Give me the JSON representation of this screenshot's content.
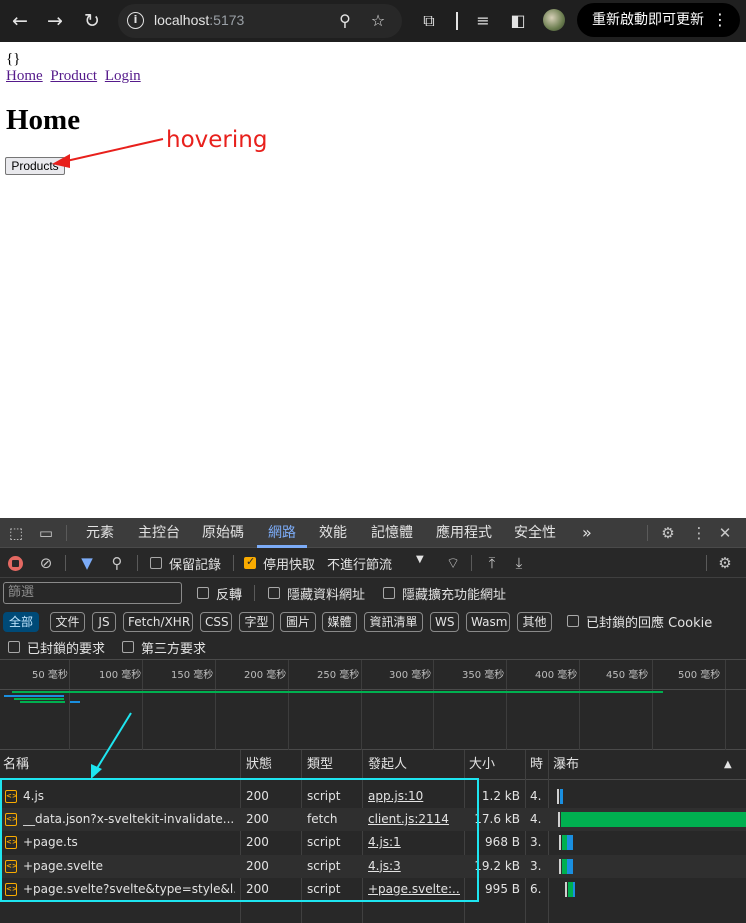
{
  "browser": {
    "url_host": "localhost",
    "url_port": ":5173",
    "update_button": "重新啟動即可更新"
  },
  "page": {
    "json_output": "{}",
    "nav_links": [
      "Home",
      "Product",
      "Login"
    ],
    "heading": "Home",
    "products_button": "Products"
  },
  "annotations": {
    "hovering_label": "hovering"
  },
  "devtools": {
    "tabs": [
      "元素",
      "主控台",
      "原始碼",
      "網路",
      "效能",
      "記憶體",
      "應用程式",
      "安全性"
    ],
    "active_tab": "網路",
    "more_tabs": "»",
    "toolbar": {
      "preserve_log": "保留記錄",
      "disable_cache": "停用快取",
      "throttling": "不進行節流"
    },
    "filter": {
      "placeholder": "篩選",
      "invert": "反轉",
      "hide_data_urls": "隱藏資料網址",
      "hide_extension_urls": "隱藏擴充功能網址"
    },
    "type_chips": [
      "全部",
      "文件",
      "JS",
      "Fetch/XHR",
      "CSS",
      "字型",
      "圖片",
      "媒體",
      "資訊清單",
      "WS",
      "Wasm",
      "其他"
    ],
    "blocked_cookies": "已封鎖的回應 Cookie",
    "blocked_requests": "已封鎖的要求",
    "third_party": "第三方要求",
    "timeline_ticks": [
      "50 毫秒",
      "100 毫秒",
      "150 毫秒",
      "200 毫秒",
      "250 毫秒",
      "300 毫秒",
      "350 毫秒",
      "400 毫秒",
      "450 毫秒",
      "500 毫秒"
    ],
    "columns": {
      "name": "名稱",
      "status": "狀態",
      "type": "類型",
      "initiator": "發起人",
      "size": "大小",
      "time": "時",
      "waterfall": "瀑布"
    },
    "requests": [
      {
        "name": "4.js",
        "status": "200",
        "type": "script",
        "initiator": "app.js:10",
        "size": "1.2 kB",
        "time": "4.",
        "wf_start_ms": 1,
        "wf_waiting_ms": 0,
        "wf_download_ms": 3
      },
      {
        "name": "__data.json?x-sveltekit-invalidate...",
        "status": "200",
        "type": "fetch",
        "initiator": "client.js:2114",
        "size": "17.6 kB",
        "time": "4.",
        "wf_start_ms": 2,
        "wf_waiting_ms": 0,
        "wf_download_ms": 200
      },
      {
        "name": "+page.ts",
        "status": "200",
        "type": "script",
        "initiator": "4.js:1",
        "size": "968 B",
        "time": "3.",
        "wf_start_ms": 3,
        "wf_waiting_ms": 2,
        "wf_download_ms": 6
      },
      {
        "name": "+page.svelte",
        "status": "200",
        "type": "script",
        "initiator": "4.js:3",
        "size": "19.2 kB",
        "time": "3.",
        "wf_start_ms": 3,
        "wf_waiting_ms": 2,
        "wf_download_ms": 6
      },
      {
        "name": "+page.svelte?svelte&type=style&l...",
        "status": "200",
        "type": "script",
        "initiator": "+page.svelte:...",
        "size": "995 B",
        "time": "6.",
        "wf_start_ms": 9,
        "wf_waiting_ms": 2,
        "wf_download_ms": 2
      }
    ],
    "colors": {
      "accent": "#7cacf8",
      "waiting": "#00b050",
      "download": "#1a8fe0"
    }
  }
}
